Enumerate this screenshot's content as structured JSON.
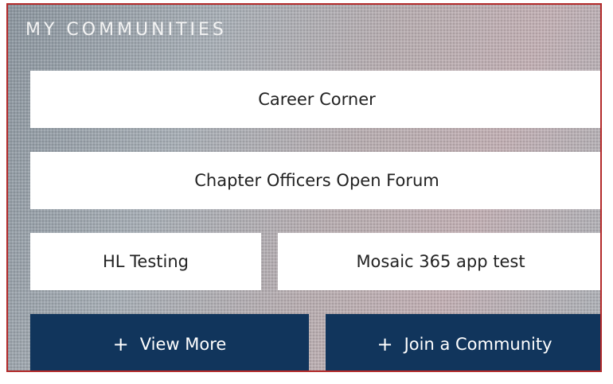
{
  "section": {
    "title": "MY COMMUNITIES"
  },
  "communities": [
    {
      "label": "Career Corner"
    },
    {
      "label": "Chapter Officers Open Forum"
    },
    {
      "label": "HL Testing"
    },
    {
      "label": "Mosaic 365 app test"
    }
  ],
  "actions": {
    "view_more": {
      "icon": "plus-icon",
      "glyph": "+",
      "label": "View More"
    },
    "join": {
      "icon": "plus-icon",
      "glyph": "+",
      "label": "Join a Community"
    }
  },
  "colors": {
    "border": "#b32a2a",
    "action_bg": "#11355c",
    "tile_bg": "#ffffff"
  }
}
